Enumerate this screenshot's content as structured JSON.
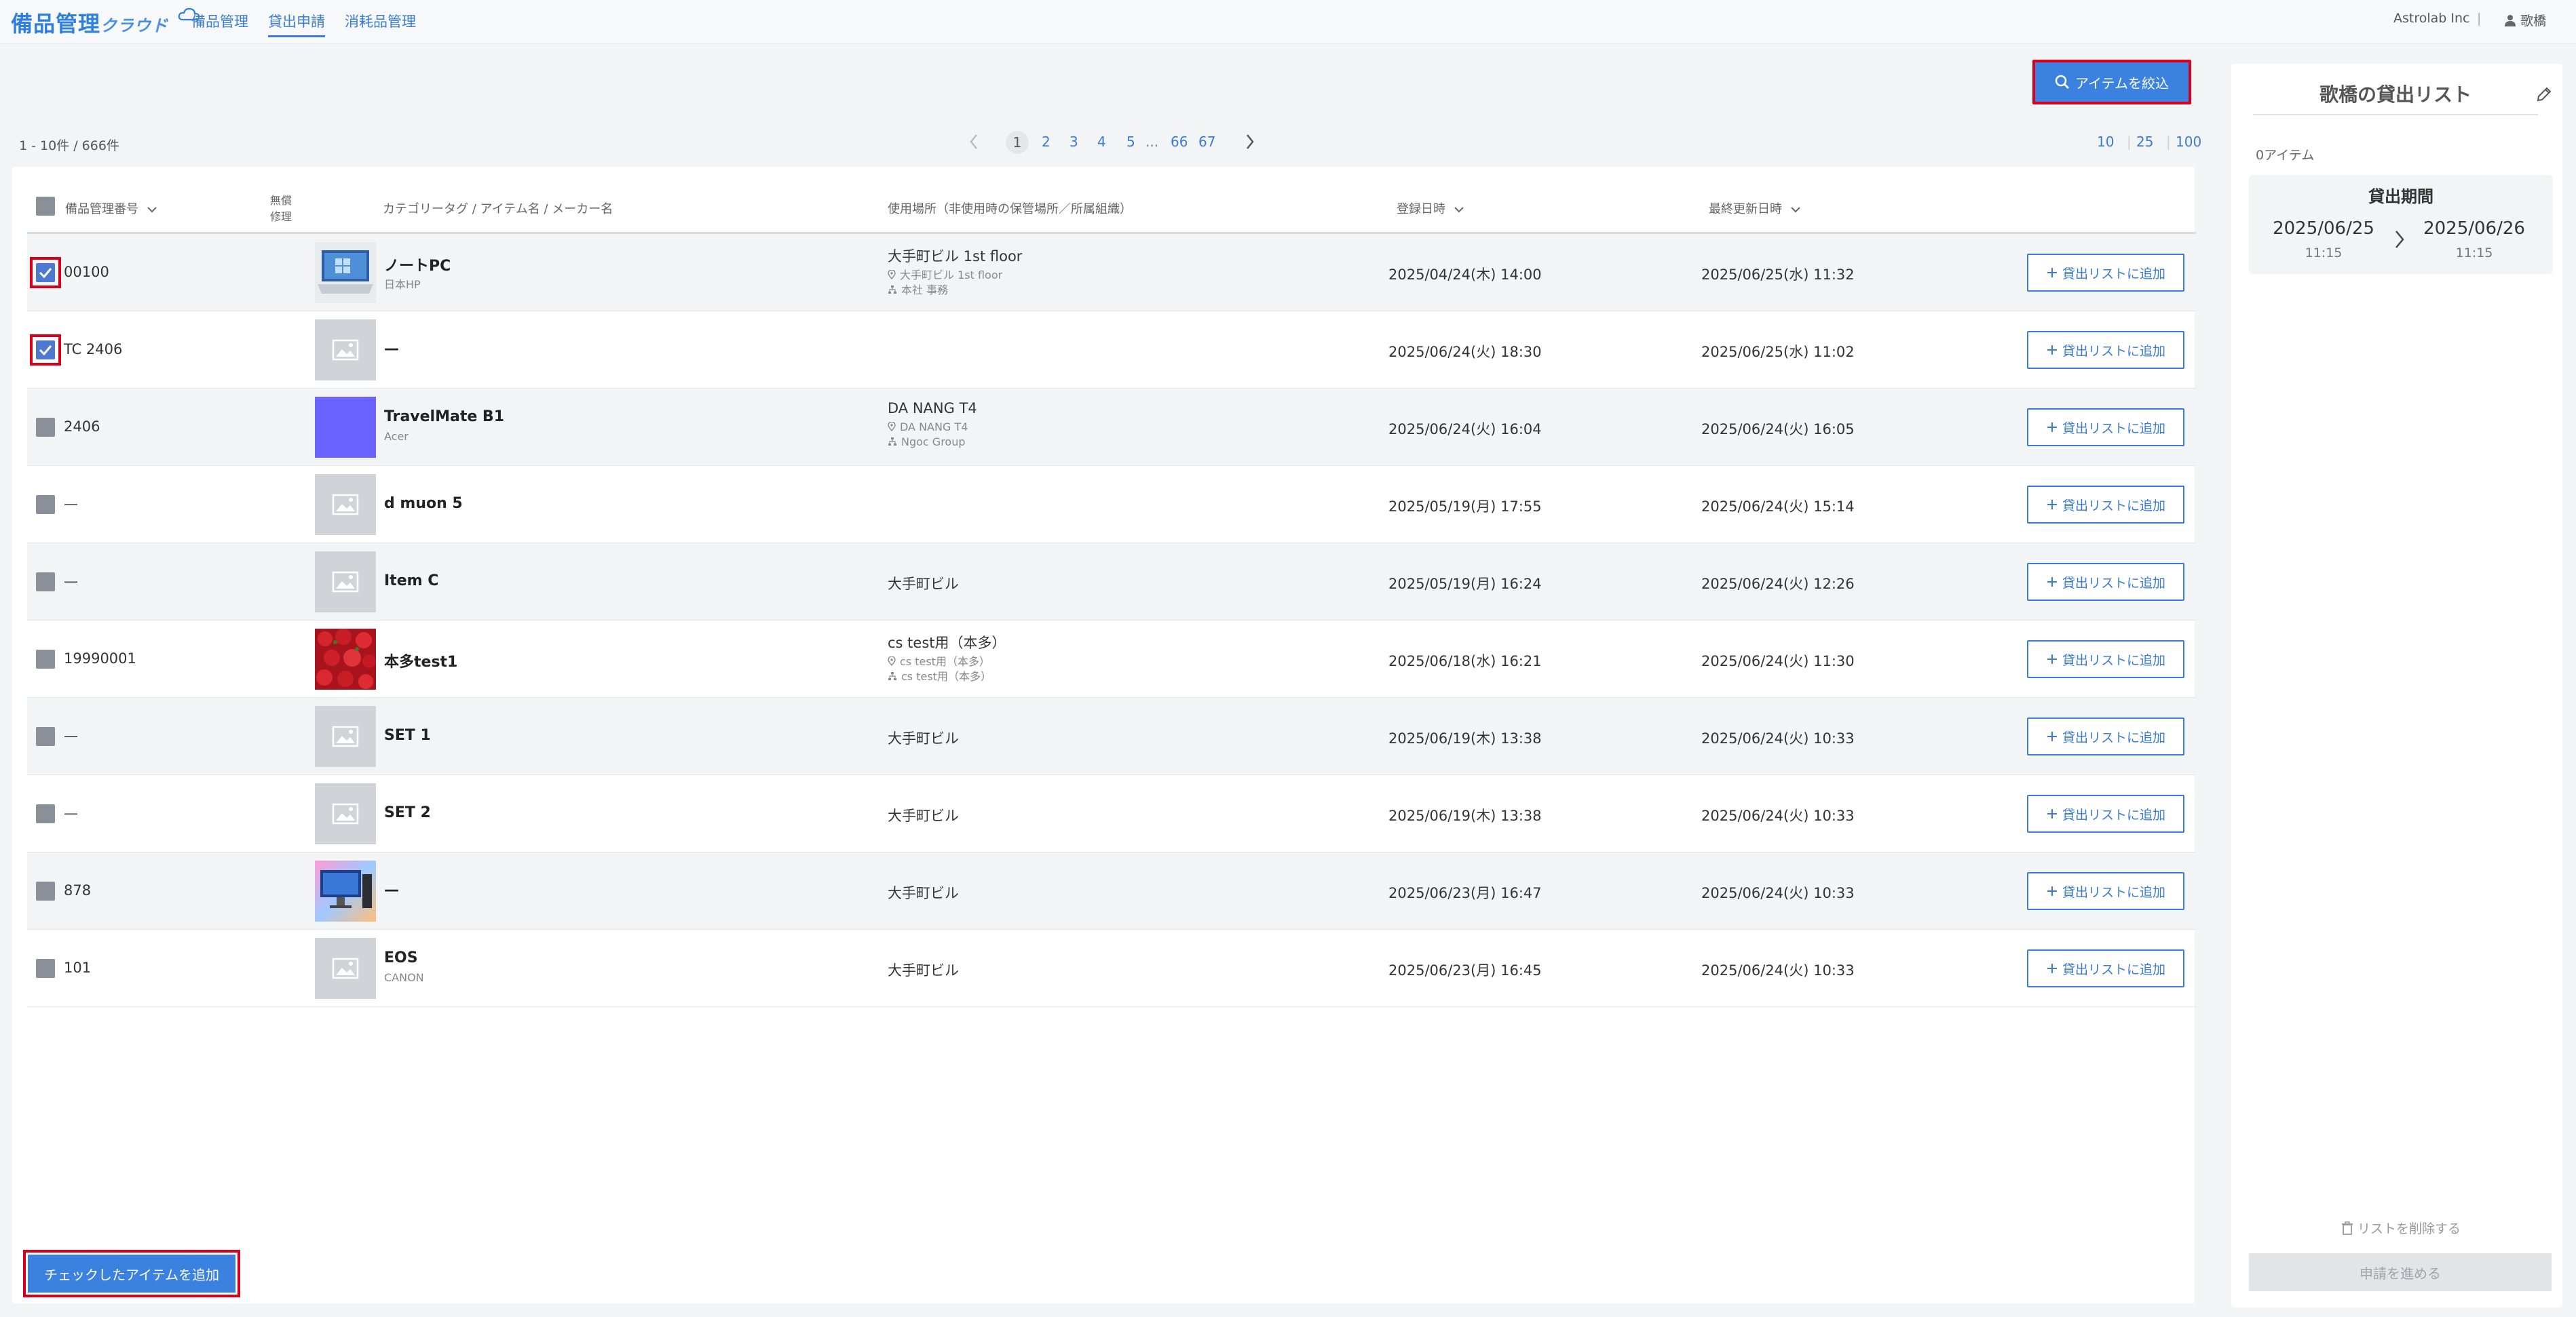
{
  "header": {
    "logo_main": "備品管理",
    "logo_sub": "クラウド",
    "nav": [
      "備品管理",
      "貸出申請",
      "消耗品管理"
    ],
    "org": "Astrolab Inc",
    "separator": "|",
    "user": "歌橋"
  },
  "toolbar": {
    "filter_label": "アイテムを絞込"
  },
  "pager": {
    "count_text": "1 - 10件 / 666件",
    "pages": [
      "1",
      "2",
      "3",
      "4",
      "5",
      "...",
      "66",
      "67"
    ],
    "current": "1",
    "sizes": [
      "10",
      "25",
      "100"
    ]
  },
  "table": {
    "headers": {
      "id": "備品管理番号",
      "repair_1": "無償",
      "repair_2": "修理",
      "item": "カテゴリータグ / アイテム名 / メーカー名",
      "location": "使用場所（非使用時の保管場所／所属組織）",
      "registered": "登録日時",
      "updated": "最終更新日時"
    },
    "add_label": "貸出リストに追加",
    "rows": [
      {
        "id": "00100",
        "checked": true,
        "name": "ノートPC",
        "maker": "日本HP",
        "thumb": "laptop",
        "loc": "大手町ビル 1st floor",
        "loc_storage": "大手町ビル 1st floor",
        "loc_org": "本社 事務",
        "registered": "2025/04/24(木) 14:00",
        "updated": "2025/06/25(水) 11:32"
      },
      {
        "id": "TC 2406",
        "checked": true,
        "name": "—",
        "maker": "",
        "thumb": "placeholder",
        "loc": "",
        "loc_storage": "",
        "loc_org": "",
        "registered": "2025/06/24(火) 18:30",
        "updated": "2025/06/25(水) 11:02"
      },
      {
        "id": "2406",
        "checked": false,
        "name": "TravelMate B1",
        "maker": "Acer",
        "thumb": "purple",
        "loc": "DA NANG T4",
        "loc_storage": "DA NANG T4",
        "loc_org": "Ngoc Group",
        "registered": "2025/06/24(火) 16:04",
        "updated": "2025/06/24(火) 16:05"
      },
      {
        "id": "—",
        "checked": false,
        "name": "d muon 5",
        "maker": "",
        "thumb": "placeholder",
        "loc": "",
        "loc_storage": "",
        "loc_org": "",
        "registered": "2025/05/19(月) 17:55",
        "updated": "2025/06/24(火) 15:14"
      },
      {
        "id": "—",
        "checked": false,
        "name": "Item C",
        "maker": "",
        "thumb": "placeholder",
        "loc": "大手町ビル",
        "loc_storage": "",
        "loc_org": "",
        "registered": "2025/05/19(月) 16:24",
        "updated": "2025/06/24(火) 12:26"
      },
      {
        "id": "19990001",
        "checked": false,
        "name": "本多test1",
        "maker": "",
        "thumb": "strawberry",
        "loc": "cs test用（本多）",
        "loc_storage": "cs test用（本多）",
        "loc_org": "cs test用（本多）",
        "registered": "2025/06/18(水) 16:21",
        "updated": "2025/06/24(火) 11:30"
      },
      {
        "id": "—",
        "checked": false,
        "name": "SET 1",
        "maker": "",
        "thumb": "placeholder",
        "loc": "大手町ビル",
        "loc_storage": "",
        "loc_org": "",
        "registered": "2025/06/19(木) 13:38",
        "updated": "2025/06/24(火) 10:33"
      },
      {
        "id": "—",
        "checked": false,
        "name": "SET 2",
        "maker": "",
        "thumb": "placeholder",
        "loc": "大手町ビル",
        "loc_storage": "",
        "loc_org": "",
        "registered": "2025/06/19(木) 13:38",
        "updated": "2025/06/24(火) 10:33"
      },
      {
        "id": "878",
        "checked": false,
        "name": "—",
        "maker": "",
        "thumb": "desktop",
        "loc": "大手町ビル",
        "loc_storage": "",
        "loc_org": "",
        "registered": "2025/06/23(月) 16:47",
        "updated": "2025/06/24(火) 10:33"
      },
      {
        "id": "101",
        "checked": false,
        "name": "EOS",
        "maker": "CANON",
        "thumb": "placeholder",
        "loc": "大手町ビル",
        "loc_storage": "",
        "loc_org": "",
        "registered": "2025/06/23(月) 16:45",
        "updated": "2025/06/24(火) 10:33"
      }
    ]
  },
  "bulk": {
    "label": "チェックしたアイテムを追加"
  },
  "panel": {
    "title": "歌橋の貸出リスト",
    "count": "0アイテム",
    "period_title": "貸出期間",
    "start_date": "2025/06/25",
    "start_time": "11:15",
    "end_date": "2025/06/26",
    "end_time": "11:15",
    "delete_label": "リストを削除する",
    "submit_label": "申請を進める"
  },
  "colors": {
    "accent": "#3a7bd5",
    "highlight": "#d9001b",
    "checkbox_checked": "#4e79d1"
  }
}
